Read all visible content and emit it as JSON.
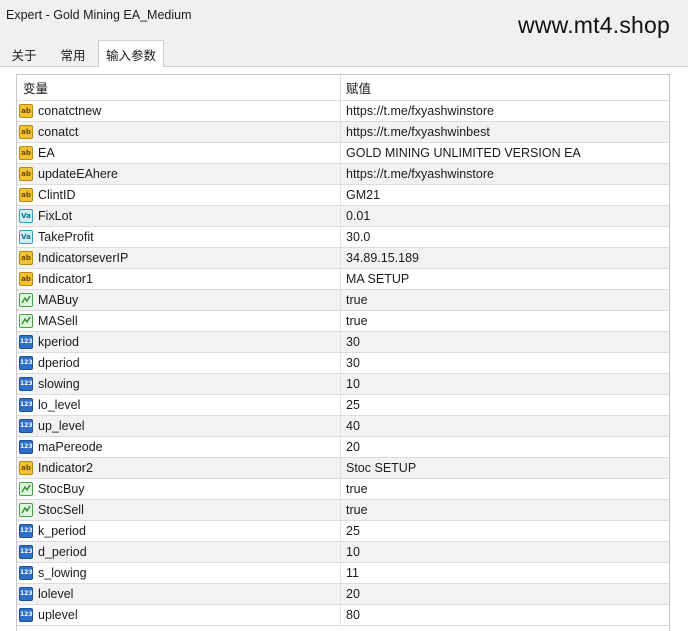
{
  "window": {
    "title": "Expert - Gold Mining EA_Medium",
    "watermark": "www.mt4.shop"
  },
  "tabs": [
    {
      "label": "关于"
    },
    {
      "label": "常用"
    },
    {
      "label": "输入参数"
    }
  ],
  "table": {
    "headers": {
      "variable": "变量",
      "value": "赋值"
    },
    "rows": [
      {
        "name": "conatctnew",
        "value": "https://t.me/fxyashwinstore",
        "type": "ab"
      },
      {
        "name": "conatct",
        "value": "https://t.me/fxyashwinbest",
        "type": "ab"
      },
      {
        "name": "EA",
        "value": "GOLD MINING UNLIMITED VERSION EA",
        "type": "ab"
      },
      {
        "name": "updateEAhere",
        "value": "https://t.me/fxyashwinstore",
        "type": "ab"
      },
      {
        "name": "ClintID",
        "value": "GM21",
        "type": "ab"
      },
      {
        "name": "FixLot",
        "value": "0.01",
        "type": "Va"
      },
      {
        "name": "TakeProfit",
        "value": "30.0",
        "type": "Va"
      },
      {
        "name": "IndicatorseverIP",
        "value": "34.89.15.189",
        "type": "ab"
      },
      {
        "name": "Indicator1",
        "value": "MA SETUP",
        "type": "ab"
      },
      {
        "name": "MABuy",
        "value": "true",
        "type": "bool"
      },
      {
        "name": "MASell",
        "value": "true",
        "type": "bool"
      },
      {
        "name": "kperiod",
        "value": "30",
        "type": "123"
      },
      {
        "name": "dperiod",
        "value": "30",
        "type": "123"
      },
      {
        "name": "slowing",
        "value": "10",
        "type": "123"
      },
      {
        "name": "lo_level",
        "value": "25",
        "type": "123"
      },
      {
        "name": "up_level",
        "value": "40",
        "type": "123"
      },
      {
        "name": "maPereode",
        "value": "20",
        "type": "123"
      },
      {
        "name": "Indicator2",
        "value": "Stoc SETUP",
        "type": "ab"
      },
      {
        "name": "StocBuy",
        "value": "true",
        "type": "bool"
      },
      {
        "name": "StocSell",
        "value": "true",
        "type": "bool"
      },
      {
        "name": "k_period",
        "value": "25",
        "type": "123"
      },
      {
        "name": "d_period",
        "value": "10",
        "type": "123"
      },
      {
        "name": "s_lowing",
        "value": "11",
        "type": "123"
      },
      {
        "name": "lolevel",
        "value": "20",
        "type": "123"
      },
      {
        "name": "uplevel",
        "value": "80",
        "type": "123"
      }
    ]
  }
}
